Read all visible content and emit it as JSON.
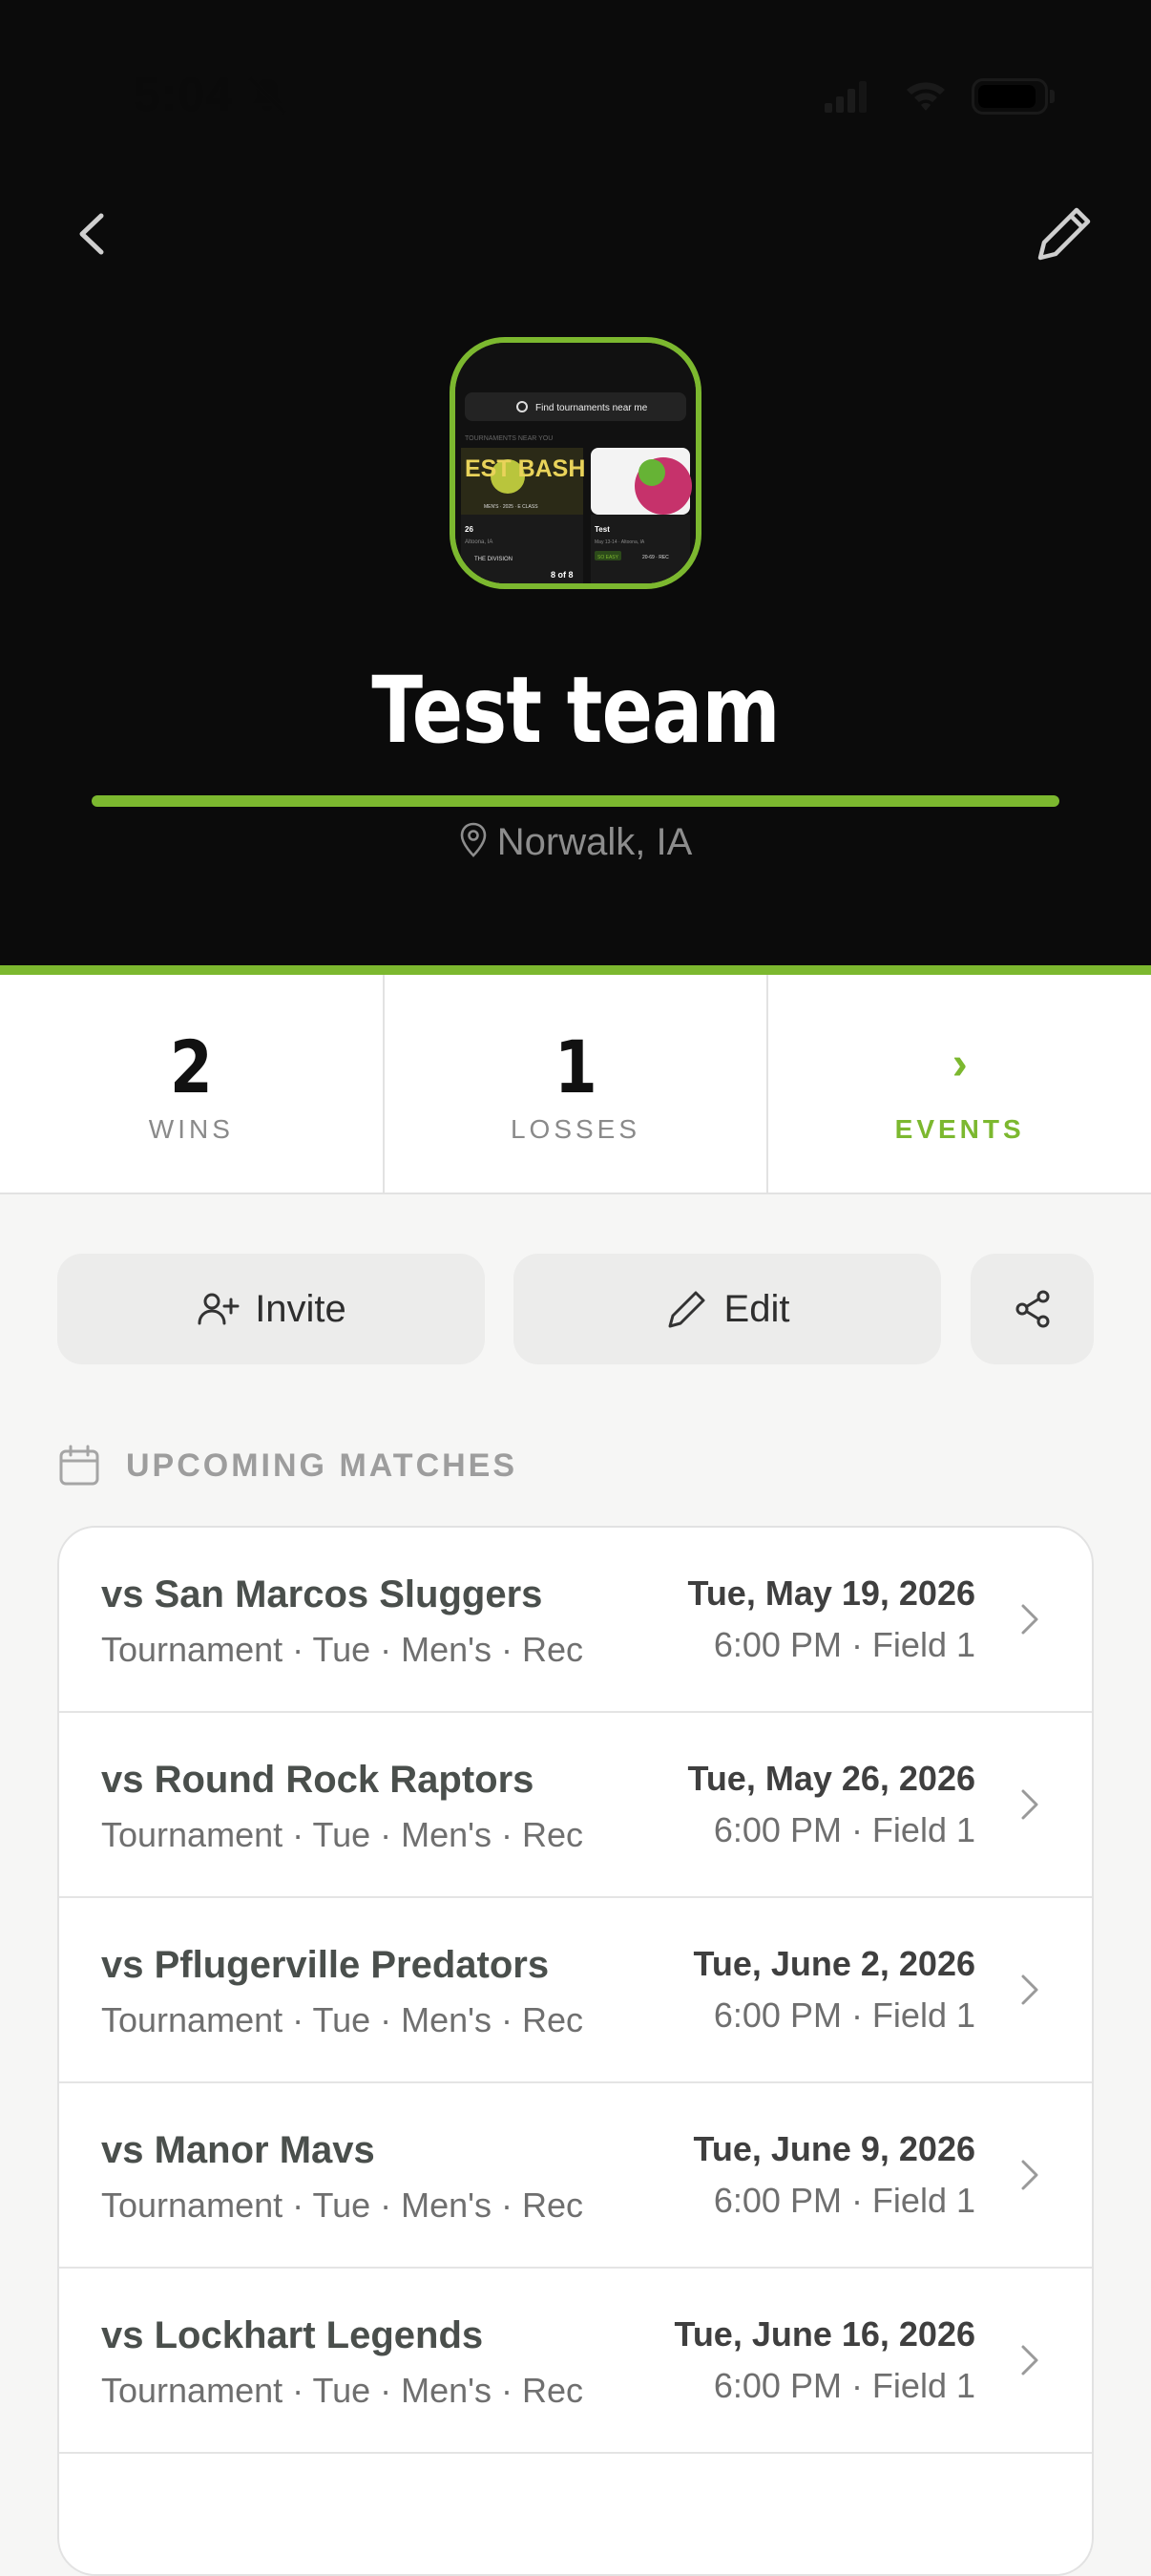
{
  "status_bar": {
    "time": "5:04"
  },
  "team": {
    "name": "Test team",
    "location": "Norwalk, IA",
    "avatar": {
      "search_text": "Find tournaments near me",
      "section_text": "TOURNAMENTS NEAR YOU",
      "card1_title": "EST BASH",
      "card1_meta": "MEN'S · 2025 · E CLASS",
      "card1_name": "26",
      "card1_place": "Altoona, IA",
      "card1_division": "THE DIVISION",
      "card1_count": "8 of 8",
      "card2_title": "Test",
      "card2_date": "May 13-14 · Altoona, IA",
      "card2_badge": "SO EASY",
      "card2_code": "20-69 · REC"
    }
  },
  "stats": [
    {
      "value": "2",
      "label": "WINS"
    },
    {
      "value": "1",
      "label": "LOSSES"
    },
    {
      "value": "›",
      "label": "EVENTS"
    }
  ],
  "actions": {
    "invite": "Invite",
    "edit": "Edit"
  },
  "section": {
    "title": "UPCOMING MATCHES"
  },
  "matches": [
    {
      "opponent": "vs San Marcos Sluggers",
      "details": "Tournament · Tue · Men's · Rec",
      "date": "Tue, May 19, 2026",
      "time": "6:00 PM · Field 1"
    },
    {
      "opponent": "vs Round Rock Raptors",
      "details": "Tournament · Tue · Men's · Rec",
      "date": "Tue, May 26, 2026",
      "time": "6:00 PM · Field 1"
    },
    {
      "opponent": "vs Pflugerville Predators",
      "details": "Tournament · Tue · Men's · Rec",
      "date": "Tue, June 2, 2026",
      "time": "6:00 PM · Field 1"
    },
    {
      "opponent": "vs Manor Mavs",
      "details": "Tournament · Tue · Men's · Rec",
      "date": "Tue, June 9, 2026",
      "time": "6:00 PM · Field 1"
    },
    {
      "opponent": "vs Lockhart Legends",
      "details": "Tournament · Tue · Men's · Rec",
      "date": "Tue, June 16, 2026",
      "time": "6:00 PM · Field 1"
    }
  ],
  "colors": {
    "accent": "#7cb82f",
    "hero": "#0b0b0b"
  }
}
